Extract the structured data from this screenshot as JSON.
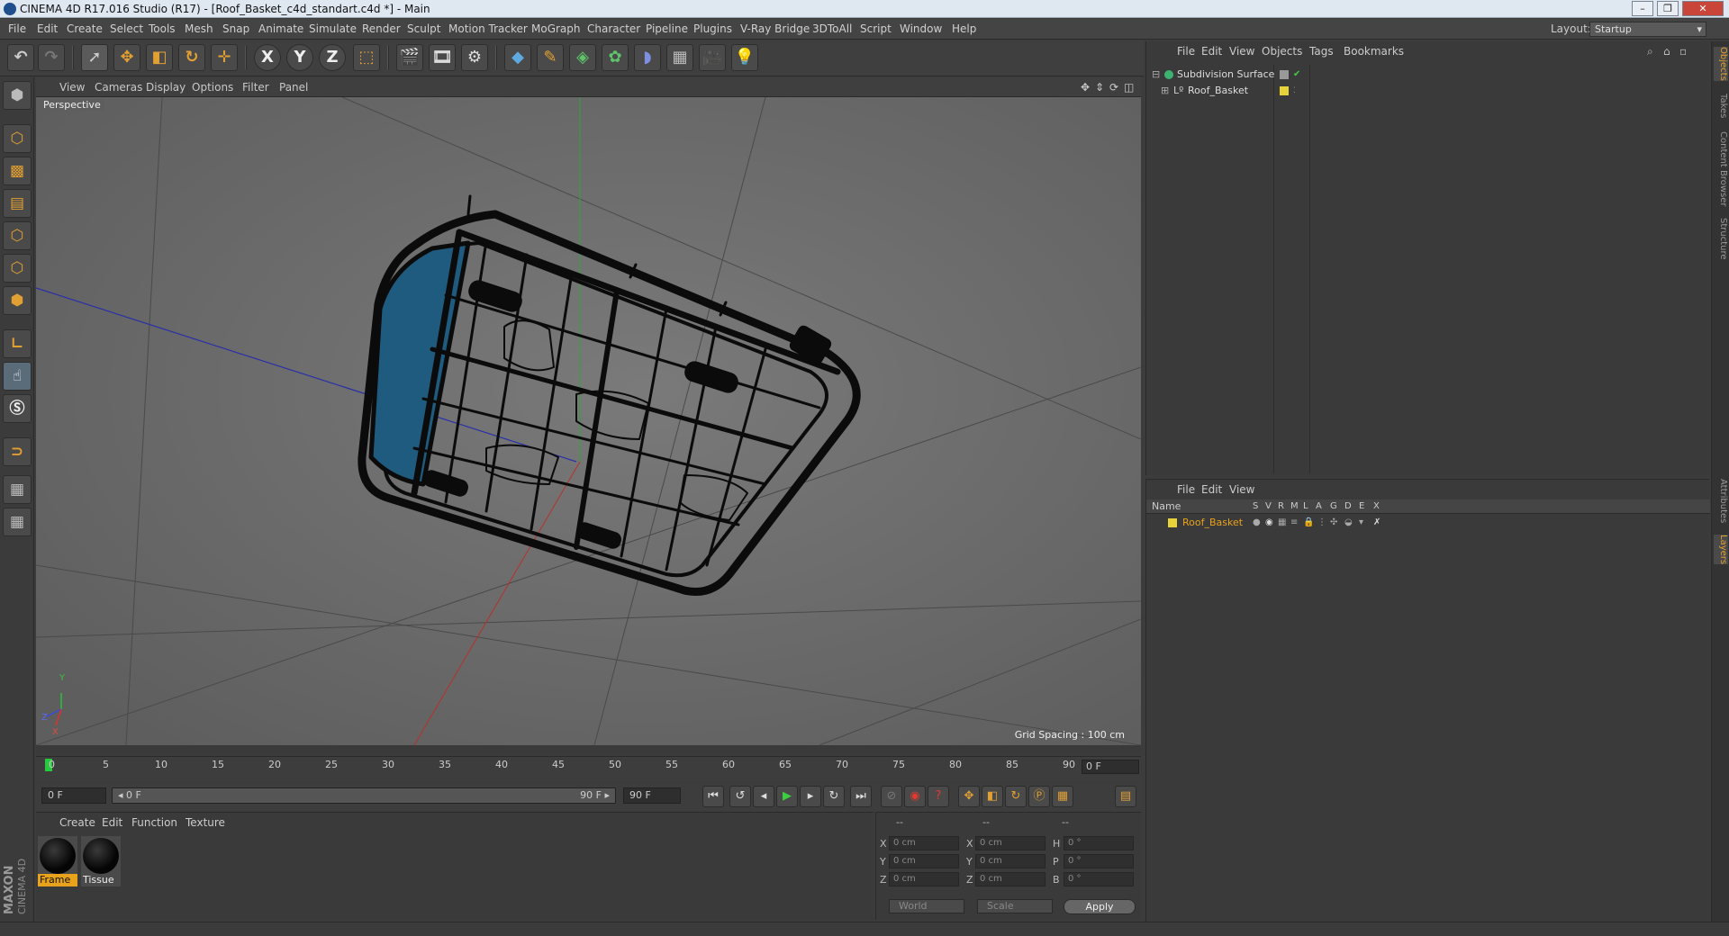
{
  "window": {
    "title": "CINEMA 4D R17.016 Studio (R17) - [Roof_Basket_c4d_standart.c4d *] - Main",
    "controls": [
      "–",
      "❐",
      "✕"
    ]
  },
  "menubar": {
    "items": [
      "File",
      "Edit",
      "Create",
      "Select",
      "Tools",
      "Mesh",
      "Snap",
      "Animate",
      "Simulate",
      "Render",
      "Sculpt",
      "Motion Tracker",
      "MoGraph",
      "Character",
      "Pipeline",
      "Plugins",
      "V-Ray Bridge",
      "3DToAll",
      "Script",
      "Window",
      "Help"
    ],
    "layout_label": "Layout:",
    "layout_value": "Startup"
  },
  "toolbar": {
    "axis_x": "X",
    "axis_y": "Y",
    "axis_z": "Z"
  },
  "viewport": {
    "menu": [
      "View",
      "Cameras",
      "Display",
      "Options",
      "Filter",
      "Panel"
    ],
    "label": "Perspective",
    "grid_spacing": "Grid Spacing : 100 cm",
    "axis_y_label": "Y",
    "axis_x_label": "X",
    "axis_z_label": "Z"
  },
  "timeline": {
    "ticks": [
      "0",
      "5",
      "10",
      "15",
      "20",
      "25",
      "30",
      "35",
      "40",
      "45",
      "50",
      "55",
      "60",
      "65",
      "70",
      "75",
      "80",
      "85",
      "90"
    ],
    "current_frame": "0 F"
  },
  "transport": {
    "start_field": "0 F",
    "range_start": "◂ 0 F",
    "range_end": "90 F ▸",
    "end_field": "90 F"
  },
  "materials": {
    "menu": [
      "Create",
      "Edit",
      "Function",
      "Texture"
    ],
    "items": [
      {
        "name": "Frame",
        "selected": true
      },
      {
        "name": "Tissue",
        "selected": false
      }
    ]
  },
  "coordinates": {
    "header": [
      "--",
      "--",
      "--"
    ],
    "rows": [
      {
        "axis": "X",
        "pos": "0 cm",
        "size_axis": "X",
        "size": "0 cm",
        "rot_axis": "H",
        "rot": "0 °"
      },
      {
        "axis": "Y",
        "pos": "0 cm",
        "size_axis": "Y",
        "size": "0 cm",
        "rot_axis": "P",
        "rot": "0 °"
      },
      {
        "axis": "Z",
        "pos": "0 cm",
        "size_axis": "Z",
        "size": "0 cm",
        "rot_axis": "B",
        "rot": "0 °"
      }
    ],
    "space": "World",
    "mode": "Scale",
    "apply": "Apply"
  },
  "objects_panel": {
    "menu": [
      "File",
      "Edit",
      "View",
      "Objects",
      "Tags",
      "Bookmarks"
    ],
    "items": [
      {
        "name": "Subdivision Surface",
        "color": "#3cb371"
      },
      {
        "name": "Roof_Basket",
        "color": "#e8d23a"
      }
    ]
  },
  "layers_panel": {
    "menu": [
      "File",
      "Edit",
      "View"
    ],
    "columns": [
      "Name",
      "S",
      "V",
      "R",
      "M",
      "L",
      "A",
      "G",
      "D",
      "E",
      "X"
    ],
    "items": [
      {
        "name": "Roof_Basket",
        "color": "#e8d23a"
      }
    ]
  },
  "right_tabs": [
    "Objects",
    "Takes",
    "Content Browser",
    "Structure",
    "Attributes",
    "Layers"
  ],
  "branding": {
    "maxon": "MAXON",
    "product": "CINEMA 4D"
  },
  "colors": {
    "accent": "#e2a033",
    "viewport_bg": "#6d6d6d",
    "panel_bg": "#3a3a3a",
    "selected_label": "#e8a21c"
  }
}
